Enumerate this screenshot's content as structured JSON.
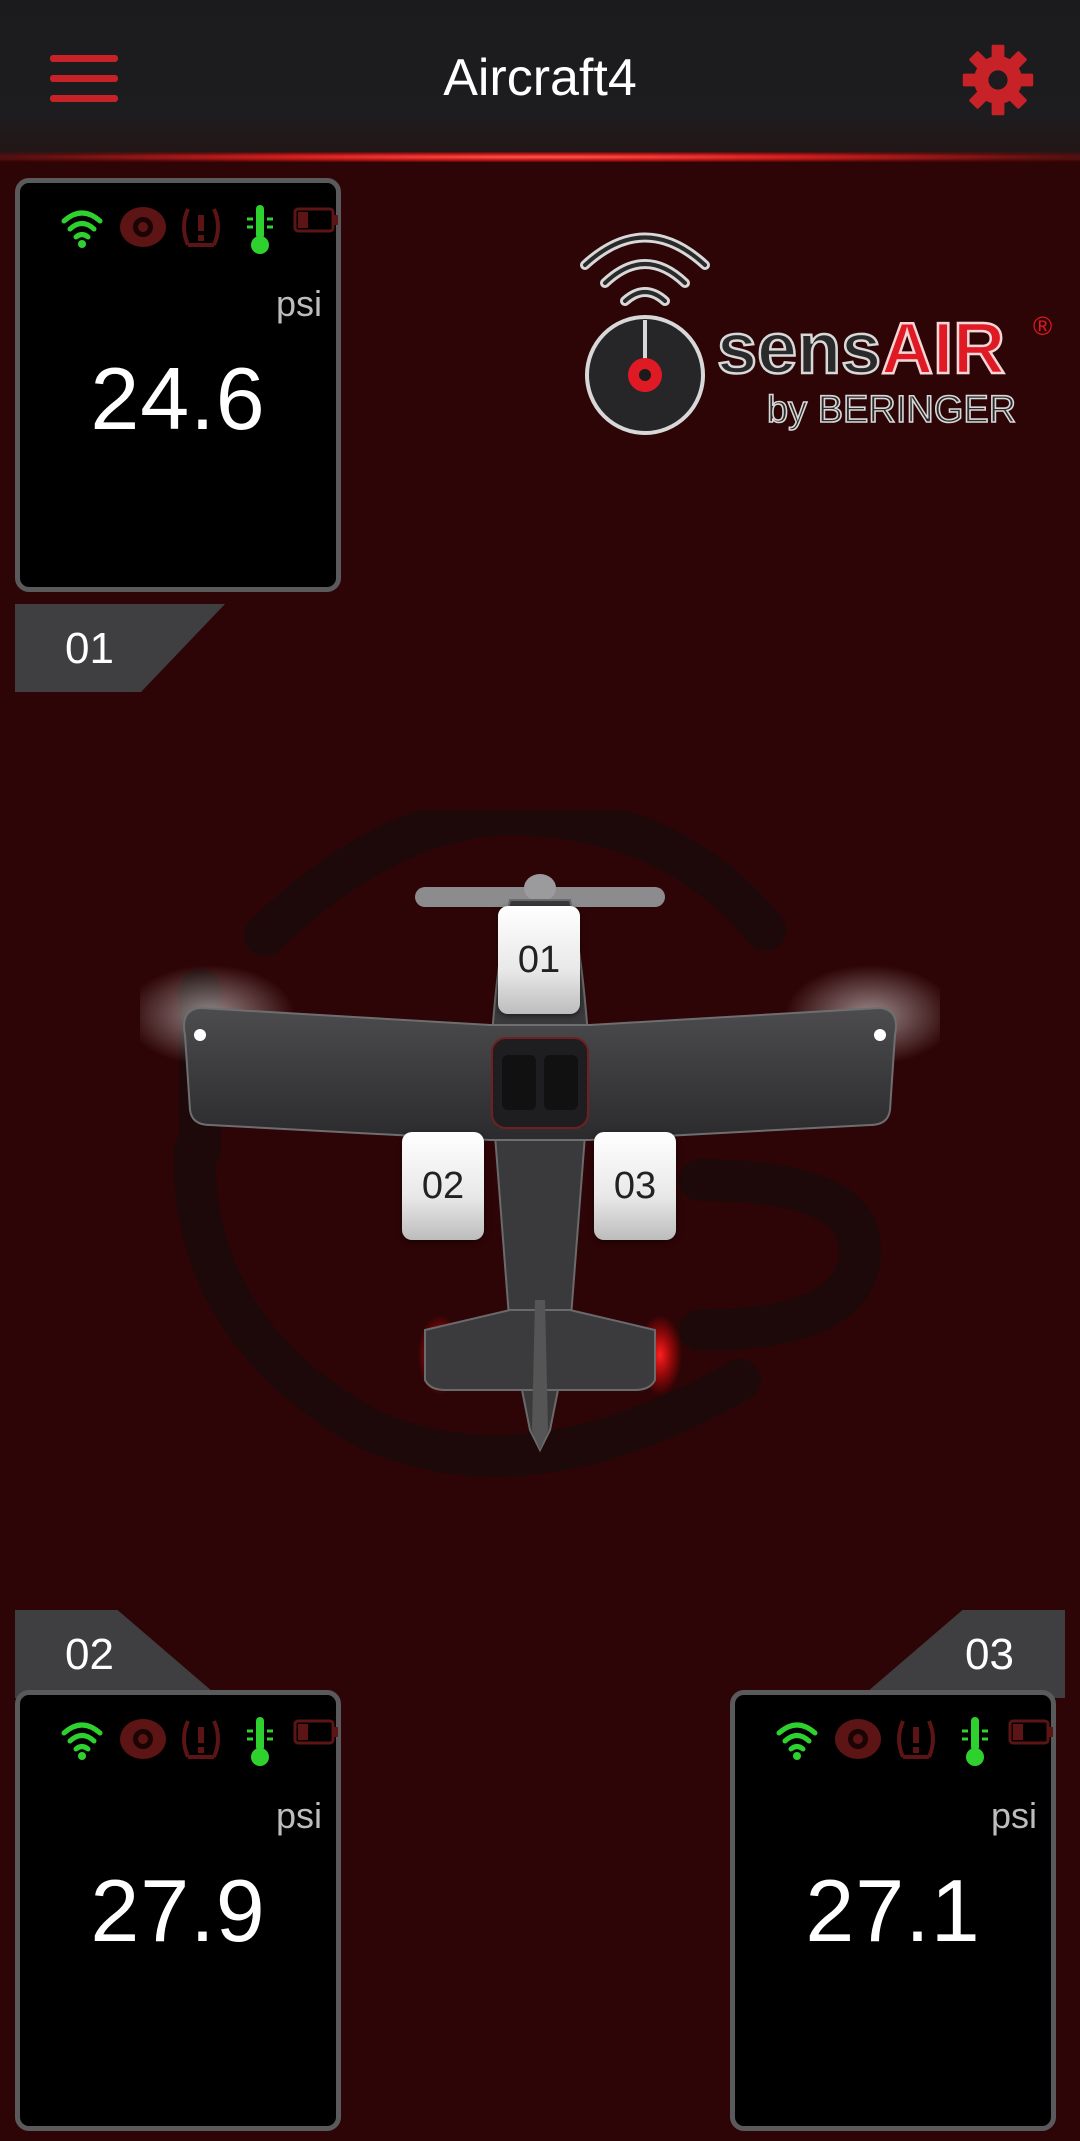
{
  "header": {
    "title": "Aircraft4"
  },
  "logo": {
    "brand_part1": "sens",
    "brand_part2": "AIR",
    "registered": "®",
    "byline": "by BERINGER"
  },
  "unit": "psi",
  "sensors": [
    {
      "id": "01",
      "value": "24.6",
      "unit": "psi"
    },
    {
      "id": "02",
      "value": "27.9",
      "unit": "psi"
    },
    {
      "id": "03",
      "value": "27.1",
      "unit": "psi"
    }
  ],
  "wheel_badges": [
    "01",
    "02",
    "03"
  ],
  "status_icons": [
    "wifi-icon",
    "tire-icon",
    "tire-pressure-warning-icon",
    "thermometer-icon",
    "battery-icon"
  ],
  "colors": {
    "background": "#2e0506",
    "accent": "#c72228",
    "ok_green": "#2fd12f",
    "inactive_red": "#5c1414"
  }
}
